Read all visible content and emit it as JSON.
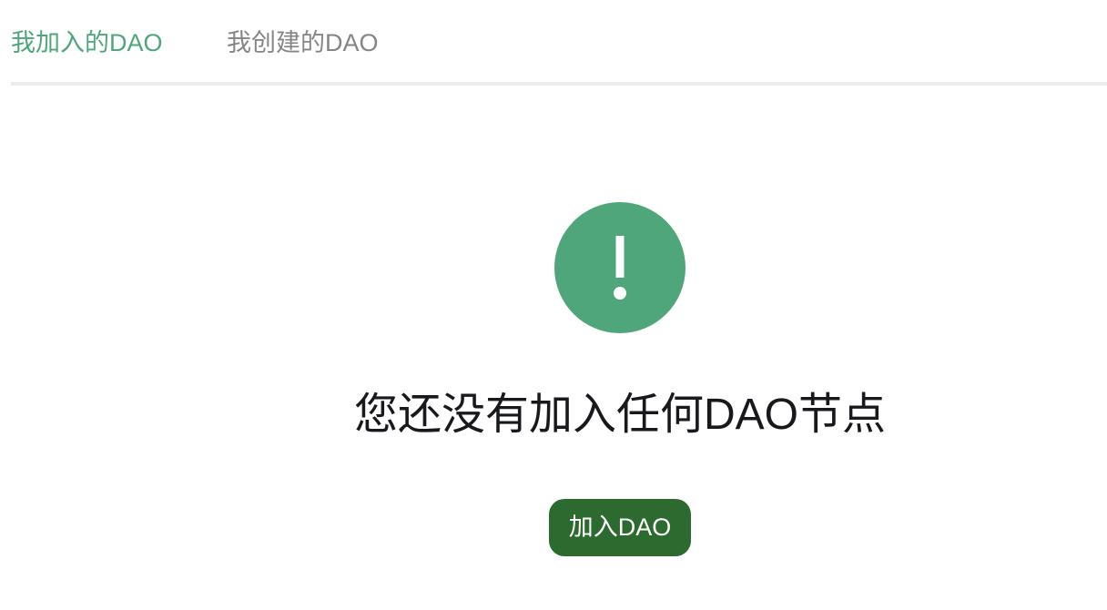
{
  "tabs": {
    "joined": "我加入的DAO",
    "created": "我创建的DAO",
    "active": "joined"
  },
  "empty_state": {
    "icon": "exclamation-circle-icon",
    "message": "您还没有加入任何DAO节点",
    "button_label": "加入DAO"
  },
  "colors": {
    "accent": "#4ea67a",
    "button": "#2d6a2f",
    "inactive_tab": "#858585",
    "text": "#17191d",
    "divider": "#ececec"
  }
}
